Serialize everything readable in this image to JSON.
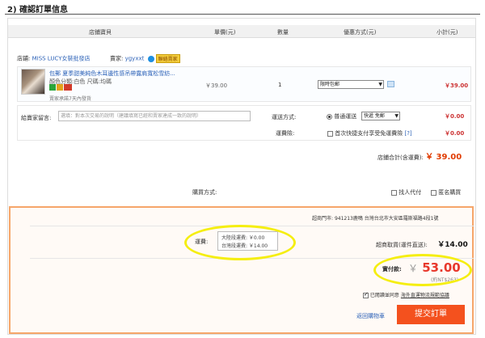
{
  "section": {
    "title": "2) 確認訂單信息"
  },
  "table_headers": [
    "店鋪寶貝",
    "單價(元)",
    "數量",
    "優惠方式(元)",
    "小計(元)"
  ],
  "store": {
    "label": "店鋪:",
    "name": "MISS LUCY女裝批發店",
    "seller_label": "賣家:",
    "seller": "ygyxxt",
    "contact_badge": "聯絡賣家"
  },
  "product": {
    "name": "包郵 夏季甜美純色木耳邊性感吊帶露肩寬松雪紡...",
    "spec": "顏色分類:白色   尺碼:均碼",
    "note": "賣家承諾7天內發貨",
    "unit_price": "￥39.00",
    "quantity": "1",
    "discount_select": "限時包郵",
    "subtotal": "￥39.00"
  },
  "options": {
    "memo_label": "給賣家留言:",
    "memo_placeholder": "選填：對本次交易的說明（建議填寫已經和賣家達成一致的說明）",
    "shipping_label": "運送方式:",
    "shipping_radio_label": "普通運送",
    "shipping_select": "快遞 免郵",
    "shipping_fee": "￥0.00",
    "insurance_label": "運費險:",
    "insurance_text": "首次快捷支付享受免運費險",
    "insurance_help": "[?]",
    "insurance_fee": "￥0.00"
  },
  "store_total": {
    "label": "店鋪合計(含運費):",
    "amount": "￥ 39.00"
  },
  "payer": {
    "label": "購買方式:",
    "proxy_label": "找人代付",
    "anon_label": "匿名購買"
  },
  "summary": {
    "address_label": "超商門市:",
    "address": "941213鹿鳴 台灣台北市大安區羅斯福路4段1號",
    "fee_label": "運費:",
    "mainland_fee": "大陸段運費: ￥0.00",
    "taiwan_fee": "台灣段運費: ￥14.00",
    "pickup_label": "超商取貨(運件直送):",
    "pickup_amount": "￥14.00",
    "pay_label": "實付款:",
    "pay_currency": "￥",
    "pay_amount": "53.00",
    "pay_ntd": "(約NT$263)",
    "agree_prefix": "已閱讀並同意",
    "agree_link": "海外直運物流規範協議"
  },
  "actions": {
    "back_label": "返回購物車",
    "submit_label": "提交訂單"
  },
  "colors": {
    "accent": "#f4511e",
    "price": "#e8382c",
    "link": "#2e63b8",
    "highlight": "#f5ee10"
  }
}
